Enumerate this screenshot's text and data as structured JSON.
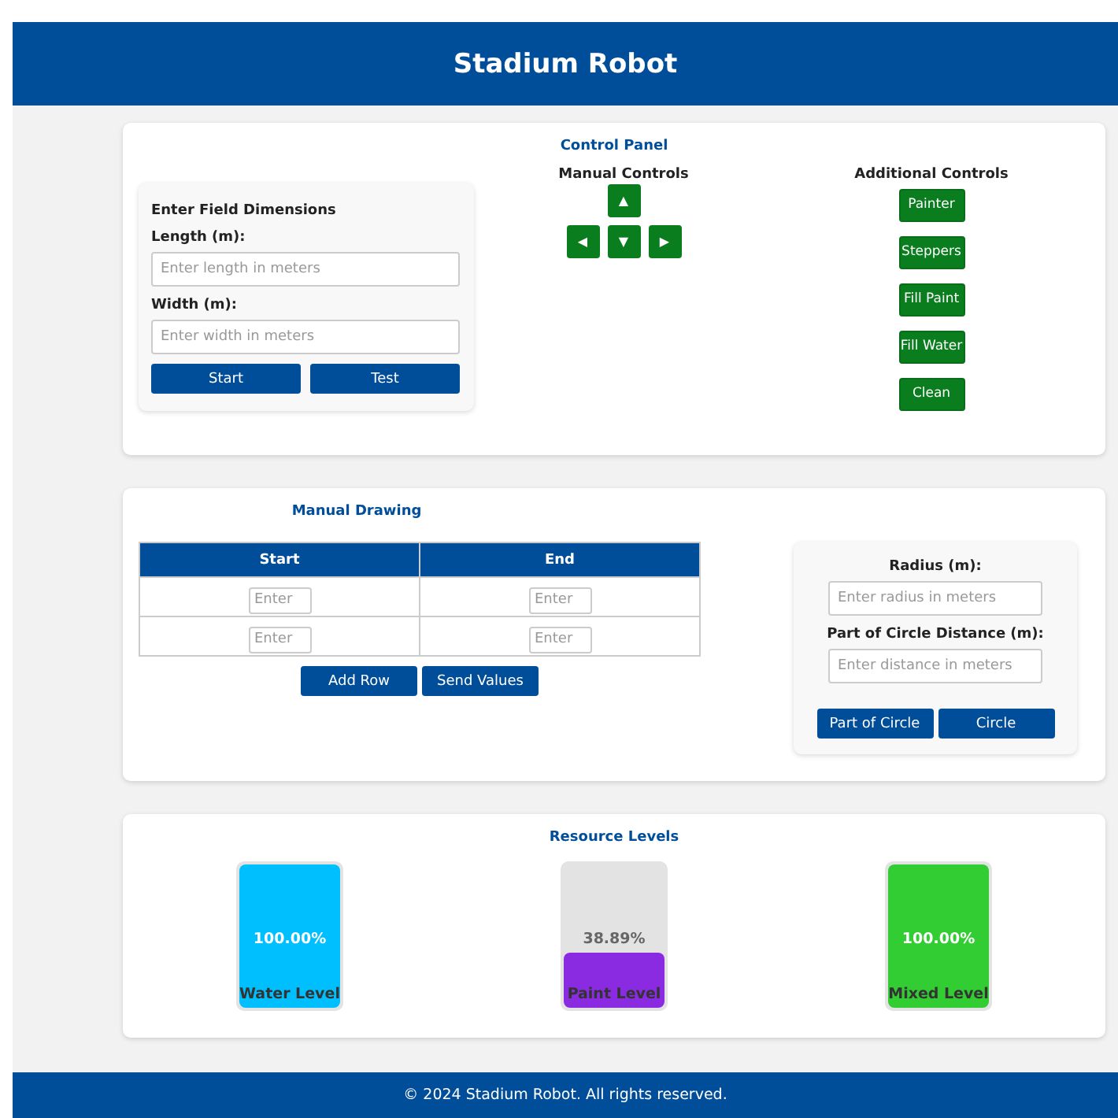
{
  "header": {
    "title": "Stadium Robot"
  },
  "control_panel": {
    "title": "Control Panel",
    "field_dimensions": {
      "title": "Enter Field Dimensions",
      "fields": [
        {
          "label": "Length (m):",
          "placeholder": "Enter length in meters"
        },
        {
          "label": "Width (m):",
          "placeholder": "Enter width in meters"
        }
      ],
      "buttons": [
        "Start",
        "Test"
      ]
    },
    "manual_controls": {
      "title": "Manual Controls",
      "up": "▲",
      "left": "◀",
      "down": "▼",
      "right": "▶"
    },
    "additional_controls": {
      "title": "Additional Controls",
      "buttons": [
        "Painter",
        "Steppers",
        "Fill Paint",
        "Fill Water",
        "Clean"
      ]
    }
  },
  "manual_drawing": {
    "title": "Manual Drawing",
    "columns": [
      "Start",
      "End"
    ],
    "rows": [
      {
        "start_placeholder": "Enter",
        "end_placeholder": "Enter"
      },
      {
        "start_placeholder": "Enter",
        "end_placeholder": "Enter"
      }
    ],
    "buttons": [
      "Add Row",
      "Send Values"
    ],
    "circle": {
      "fields": [
        {
          "label": "Radius (m):",
          "placeholder": "Enter radius in meters"
        },
        {
          "label": "Part of Circle Distance (m):",
          "placeholder": "Enter distance in meters"
        }
      ],
      "buttons": [
        "Part of Circle",
        "Circle"
      ]
    }
  },
  "resource_levels": {
    "title": "Resource Levels",
    "gauges": [
      {
        "label": "Water Level",
        "reading": "100.00%",
        "level": 1.0,
        "color": "#00bfff"
      },
      {
        "label": "Paint Level",
        "reading": "38.89%",
        "level": 0.3889,
        "color": "#8a2be2"
      },
      {
        "label": "Mixed Level",
        "reading": "100.00%",
        "level": 1.0,
        "color": "#32cd32"
      }
    ]
  },
  "footer": {
    "text": "© 2024 Stadium Robot. All rights reserved."
  }
}
